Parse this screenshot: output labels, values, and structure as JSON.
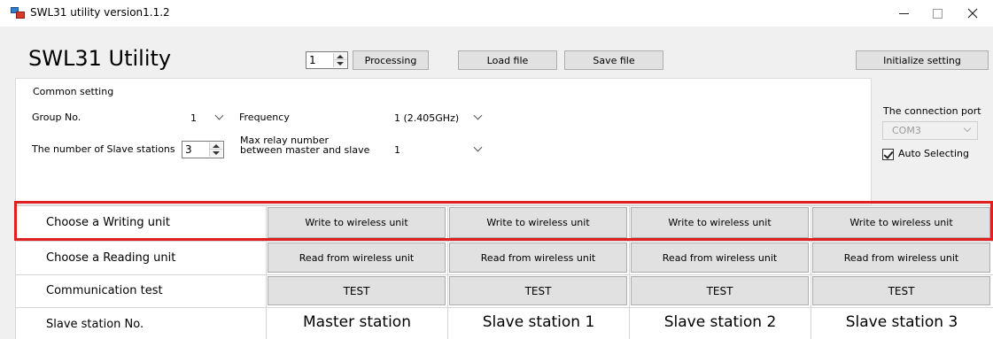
{
  "window": {
    "title": "SWL31 utility version1.1.2",
    "icon": "app-icon",
    "controls": [
      "minimize-icon",
      "maximize-icon",
      "close-icon"
    ]
  },
  "header": {
    "app_title": "SWL31 Utility",
    "unit_spinner_value": "1",
    "processing_label": "Processing",
    "load_file_label": "Load file",
    "save_file_label": "Save file",
    "initialize_label": "Initialize setting"
  },
  "common_setting": {
    "title": "Common setting",
    "group_no_label": "Group No.",
    "group_no_value": "1",
    "slave_count_label": "The number of Slave stations",
    "slave_count_value": "3",
    "frequency_label": "Frequency",
    "frequency_value": "1 (2.405GHz)",
    "max_relay_label_line1": "Max relay number",
    "max_relay_label_line2": "between master and slave",
    "max_relay_value": "1"
  },
  "connection": {
    "label": "The connection port",
    "port_value": "COM3",
    "auto_select_label": "Auto Selecting",
    "auto_select_checked": true
  },
  "grid": {
    "rows": {
      "write_label": "Choose a Writing unit",
      "read_label": "Choose a Reading unit",
      "test_label": "Communication test",
      "station_label": "Slave station No."
    },
    "write_buttons": [
      "Write to wireless unit",
      "Write to wireless unit",
      "Write to wireless unit",
      "Write to wireless unit"
    ],
    "read_buttons": [
      "Read from wireless unit",
      "Read from wireless unit",
      "Read from wireless unit",
      "Read from wireless unit"
    ],
    "test_buttons": [
      "TEST",
      "TEST",
      "TEST",
      "TEST"
    ],
    "stations": [
      "Master station",
      "Slave station 1",
      "Slave station 2",
      "Slave station 3"
    ]
  },
  "colors": {
    "highlight": "#e0201f",
    "button_face": "#e1e1e1"
  }
}
